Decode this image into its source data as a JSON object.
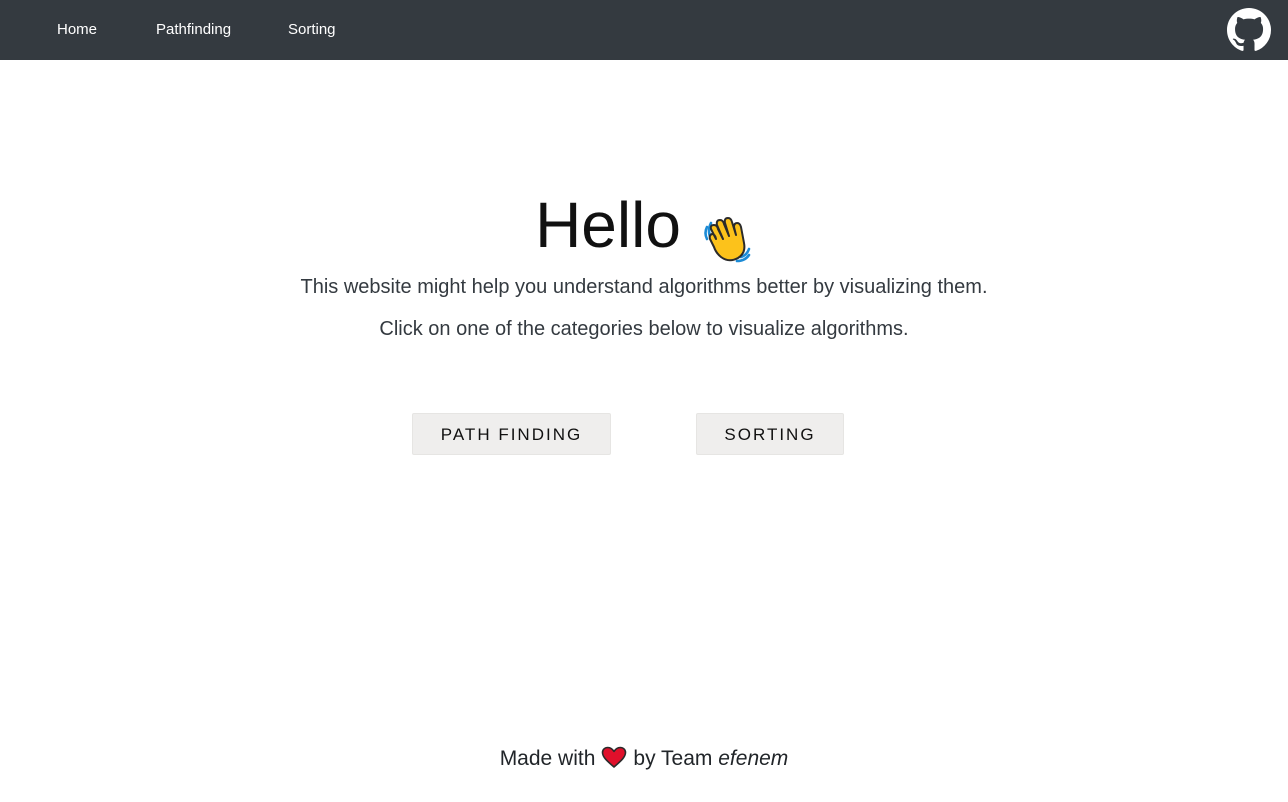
{
  "navbar": {
    "links": [
      {
        "label": "Home"
      },
      {
        "label": "Pathfinding"
      },
      {
        "label": "Sorting"
      }
    ],
    "github_icon": "github-icon"
  },
  "hero": {
    "title": "Hello",
    "emoji": "waving-hand-icon",
    "line1": "This website might help you understand algorithms better by visualizing them.",
    "line2": "Click on one of the categories below to visualize algorithms."
  },
  "buttons": {
    "path_finding": "PATH FINDING",
    "sorting": "SORTING"
  },
  "footer": {
    "made_with": "Made with",
    "heart_icon": "heart-icon",
    "by_team": "by Team",
    "team_name": "efenem"
  },
  "colors": {
    "navbar_bg": "#343a40",
    "button_bg": "#efeeed",
    "heart": "#e0102b"
  }
}
